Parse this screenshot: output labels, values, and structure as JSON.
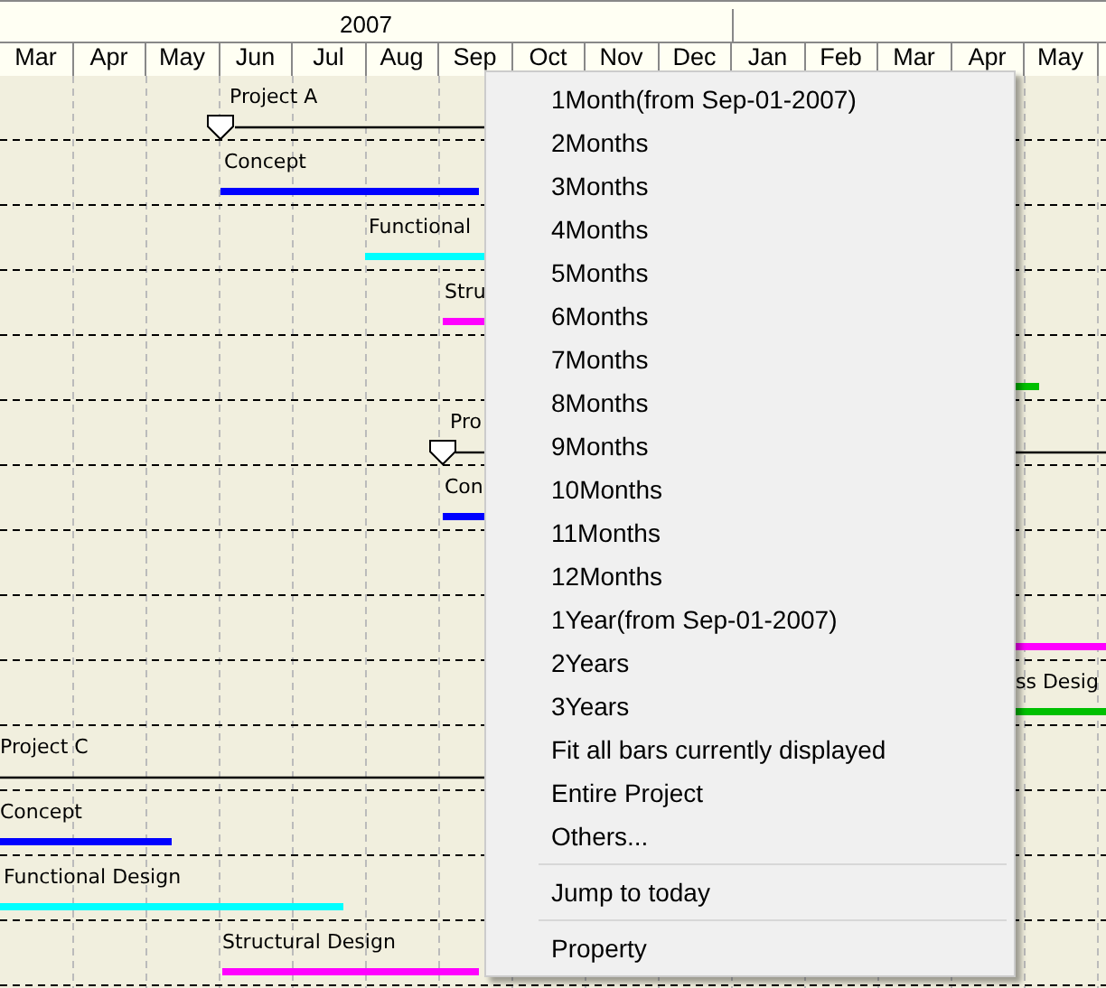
{
  "timeline": {
    "year": "2007",
    "months": [
      "Mar",
      "Apr",
      "May",
      "Jun",
      "Jul",
      "Aug",
      "Sep",
      "Oct",
      "Nov",
      "Dec",
      "Jan",
      "Feb",
      "Mar",
      "Apr",
      "May"
    ]
  },
  "rows": [
    {
      "kind": "project",
      "label": "Project A",
      "milestone": true
    },
    {
      "kind": "task",
      "label": "Concept",
      "color": "#0000ff"
    },
    {
      "kind": "task",
      "label": "Functional",
      "color": "#00ffff"
    },
    {
      "kind": "task",
      "label": "Stru",
      "color": "#ff00ff"
    },
    {
      "kind": "task",
      "color": "#00c000"
    },
    {
      "kind": "project",
      "label": "Pro",
      "milestone": true
    },
    {
      "kind": "task",
      "label": "Con",
      "color": "#0000ff"
    },
    {
      "kind": "empty"
    },
    {
      "kind": "task",
      "color": "#ff00ff"
    },
    {
      "kind": "task",
      "label": "ss Desig",
      "color": "#00c000"
    },
    {
      "kind": "project",
      "label": "Project C",
      "milestone": false
    },
    {
      "kind": "task",
      "label": "Concept",
      "color": "#0000ff"
    },
    {
      "kind": "task",
      "label": "Functional Design",
      "color": "#00ffff"
    },
    {
      "kind": "task",
      "label": "Structural Design",
      "color": "#ff00ff"
    }
  ],
  "context_menu": [
    {
      "label": "1Month(from Sep-01-2007)",
      "separator_before": false
    },
    {
      "label": "2Months",
      "separator_before": false
    },
    {
      "label": "3Months",
      "separator_before": false
    },
    {
      "label": "4Months",
      "separator_before": false
    },
    {
      "label": "5Months",
      "separator_before": false
    },
    {
      "label": "6Months",
      "separator_before": false
    },
    {
      "label": "7Months",
      "separator_before": false
    },
    {
      "label": "8Months",
      "separator_before": false
    },
    {
      "label": "9Months",
      "separator_before": false
    },
    {
      "label": "10Months",
      "separator_before": false
    },
    {
      "label": "11Months",
      "separator_before": false
    },
    {
      "label": "12Months",
      "separator_before": false
    },
    {
      "label": "1Year(from Sep-01-2007)",
      "separator_before": false
    },
    {
      "label": "2Years",
      "separator_before": false
    },
    {
      "label": "3Years",
      "separator_before": false
    },
    {
      "label": "Fit all bars currently displayed",
      "separator_before": false
    },
    {
      "label": "Entire Project",
      "separator_before": false
    },
    {
      "label": "Others...",
      "separator_before": false
    },
    {
      "label": "Jump to today",
      "separator_before": true
    },
    {
      "label": "Property",
      "separator_before": true
    }
  ]
}
